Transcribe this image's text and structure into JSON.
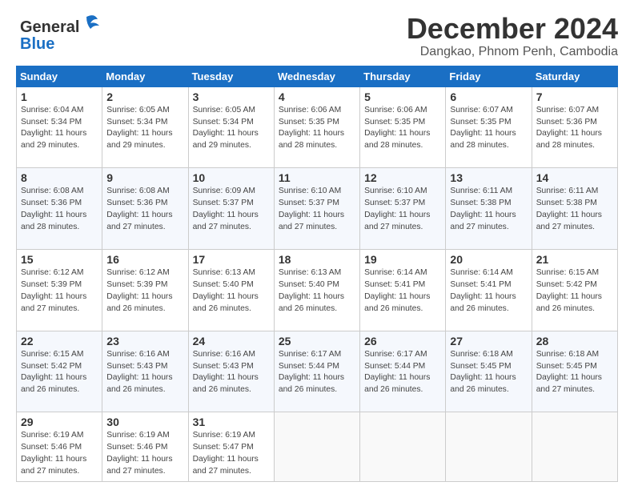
{
  "logo": {
    "line1": "General",
    "line2": "Blue"
  },
  "title": "December 2024",
  "subtitle": "Dangkao, Phnom Penh, Cambodia",
  "days_of_week": [
    "Sunday",
    "Monday",
    "Tuesday",
    "Wednesday",
    "Thursday",
    "Friday",
    "Saturday"
  ],
  "weeks": [
    [
      {
        "day": "1",
        "sunrise": "6:04 AM",
        "sunset": "5:34 PM",
        "daylight": "11 hours and 29 minutes."
      },
      {
        "day": "2",
        "sunrise": "6:05 AM",
        "sunset": "5:34 PM",
        "daylight": "11 hours and 29 minutes."
      },
      {
        "day": "3",
        "sunrise": "6:05 AM",
        "sunset": "5:34 PM",
        "daylight": "11 hours and 29 minutes."
      },
      {
        "day": "4",
        "sunrise": "6:06 AM",
        "sunset": "5:35 PM",
        "daylight": "11 hours and 28 minutes."
      },
      {
        "day": "5",
        "sunrise": "6:06 AM",
        "sunset": "5:35 PM",
        "daylight": "11 hours and 28 minutes."
      },
      {
        "day": "6",
        "sunrise": "6:07 AM",
        "sunset": "5:35 PM",
        "daylight": "11 hours and 28 minutes."
      },
      {
        "day": "7",
        "sunrise": "6:07 AM",
        "sunset": "5:36 PM",
        "daylight": "11 hours and 28 minutes."
      }
    ],
    [
      {
        "day": "8",
        "sunrise": "6:08 AM",
        "sunset": "5:36 PM",
        "daylight": "11 hours and 28 minutes."
      },
      {
        "day": "9",
        "sunrise": "6:08 AM",
        "sunset": "5:36 PM",
        "daylight": "11 hours and 27 minutes."
      },
      {
        "day": "10",
        "sunrise": "6:09 AM",
        "sunset": "5:37 PM",
        "daylight": "11 hours and 27 minutes."
      },
      {
        "day": "11",
        "sunrise": "6:10 AM",
        "sunset": "5:37 PM",
        "daylight": "11 hours and 27 minutes."
      },
      {
        "day": "12",
        "sunrise": "6:10 AM",
        "sunset": "5:37 PM",
        "daylight": "11 hours and 27 minutes."
      },
      {
        "day": "13",
        "sunrise": "6:11 AM",
        "sunset": "5:38 PM",
        "daylight": "11 hours and 27 minutes."
      },
      {
        "day": "14",
        "sunrise": "6:11 AM",
        "sunset": "5:38 PM",
        "daylight": "11 hours and 27 minutes."
      }
    ],
    [
      {
        "day": "15",
        "sunrise": "6:12 AM",
        "sunset": "5:39 PM",
        "daylight": "11 hours and 27 minutes."
      },
      {
        "day": "16",
        "sunrise": "6:12 AM",
        "sunset": "5:39 PM",
        "daylight": "11 hours and 26 minutes."
      },
      {
        "day": "17",
        "sunrise": "6:13 AM",
        "sunset": "5:40 PM",
        "daylight": "11 hours and 26 minutes."
      },
      {
        "day": "18",
        "sunrise": "6:13 AM",
        "sunset": "5:40 PM",
        "daylight": "11 hours and 26 minutes."
      },
      {
        "day": "19",
        "sunrise": "6:14 AM",
        "sunset": "5:41 PM",
        "daylight": "11 hours and 26 minutes."
      },
      {
        "day": "20",
        "sunrise": "6:14 AM",
        "sunset": "5:41 PM",
        "daylight": "11 hours and 26 minutes."
      },
      {
        "day": "21",
        "sunrise": "6:15 AM",
        "sunset": "5:42 PM",
        "daylight": "11 hours and 26 minutes."
      }
    ],
    [
      {
        "day": "22",
        "sunrise": "6:15 AM",
        "sunset": "5:42 PM",
        "daylight": "11 hours and 26 minutes."
      },
      {
        "day": "23",
        "sunrise": "6:16 AM",
        "sunset": "5:43 PM",
        "daylight": "11 hours and 26 minutes."
      },
      {
        "day": "24",
        "sunrise": "6:16 AM",
        "sunset": "5:43 PM",
        "daylight": "11 hours and 26 minutes."
      },
      {
        "day": "25",
        "sunrise": "6:17 AM",
        "sunset": "5:44 PM",
        "daylight": "11 hours and 26 minutes."
      },
      {
        "day": "26",
        "sunrise": "6:17 AM",
        "sunset": "5:44 PM",
        "daylight": "11 hours and 26 minutes."
      },
      {
        "day": "27",
        "sunrise": "6:18 AM",
        "sunset": "5:45 PM",
        "daylight": "11 hours and 26 minutes."
      },
      {
        "day": "28",
        "sunrise": "6:18 AM",
        "sunset": "5:45 PM",
        "daylight": "11 hours and 27 minutes."
      }
    ],
    [
      {
        "day": "29",
        "sunrise": "6:19 AM",
        "sunset": "5:46 PM",
        "daylight": "11 hours and 27 minutes."
      },
      {
        "day": "30",
        "sunrise": "6:19 AM",
        "sunset": "5:46 PM",
        "daylight": "11 hours and 27 minutes."
      },
      {
        "day": "31",
        "sunrise": "6:19 AM",
        "sunset": "5:47 PM",
        "daylight": "11 hours and 27 minutes."
      },
      null,
      null,
      null,
      null
    ]
  ]
}
